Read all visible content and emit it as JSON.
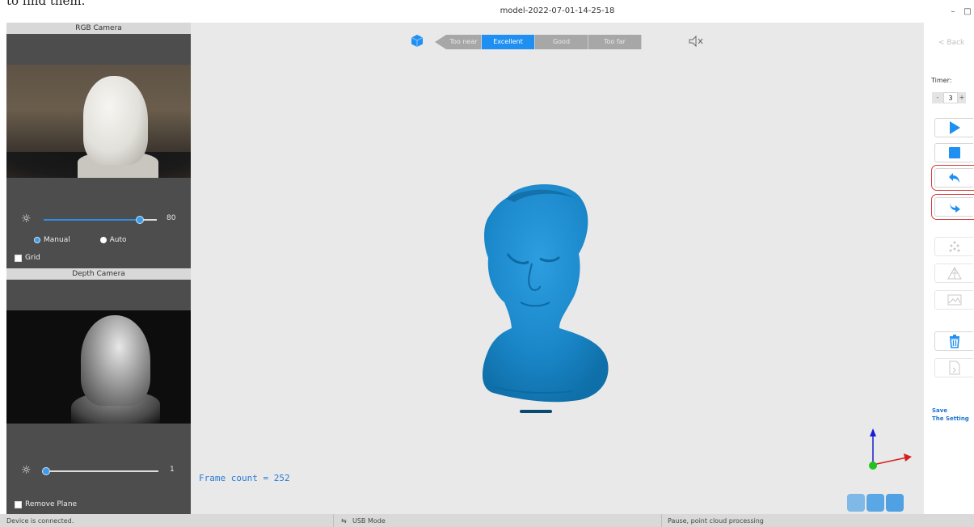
{
  "snippet_text": "to find them.",
  "window": {
    "title": "model-2022-07-01-14-25-18",
    "minimize_glyph": "–",
    "maximize_glyph": "□"
  },
  "left_panel": {
    "rgb_camera": {
      "header": "RGB Camera",
      "brightness_value": "80",
      "brightness_level": 0.85,
      "manual_label": "Manual",
      "auto_label": "Auto",
      "grid_label": "Grid"
    },
    "depth_camera": {
      "header": "Depth Camera",
      "brightness_value": "1",
      "brightness_level": 0.02,
      "remove_plane_label": "Remove Plane"
    }
  },
  "viewport": {
    "distance_segments": [
      {
        "label": "Too near",
        "active": false
      },
      {
        "label": "Excellent",
        "active": true
      },
      {
        "label": "Good",
        "active": false
      },
      {
        "label": "Too far",
        "active": false
      }
    ],
    "frame_count_text": "Frame count = 252",
    "model_color": "#1a87c9",
    "accent_color": "#1f8ff2"
  },
  "right_panel": {
    "back_label": "< Back",
    "timer_label": "Timer:",
    "timer_minus": "-",
    "timer_value": "3",
    "timer_plus": "+",
    "save_label_line1": "Save",
    "save_label_line2": "The Setting"
  },
  "icons": {
    "play": "play-icon",
    "stop": "stop-icon",
    "undo": "undo-icon",
    "redo": "redo-icon",
    "delete": "trash-icon"
  },
  "status_bar": {
    "device_status": "Device is connected.",
    "mode": "USB Mode",
    "processing": "Pause, point cloud processing"
  }
}
